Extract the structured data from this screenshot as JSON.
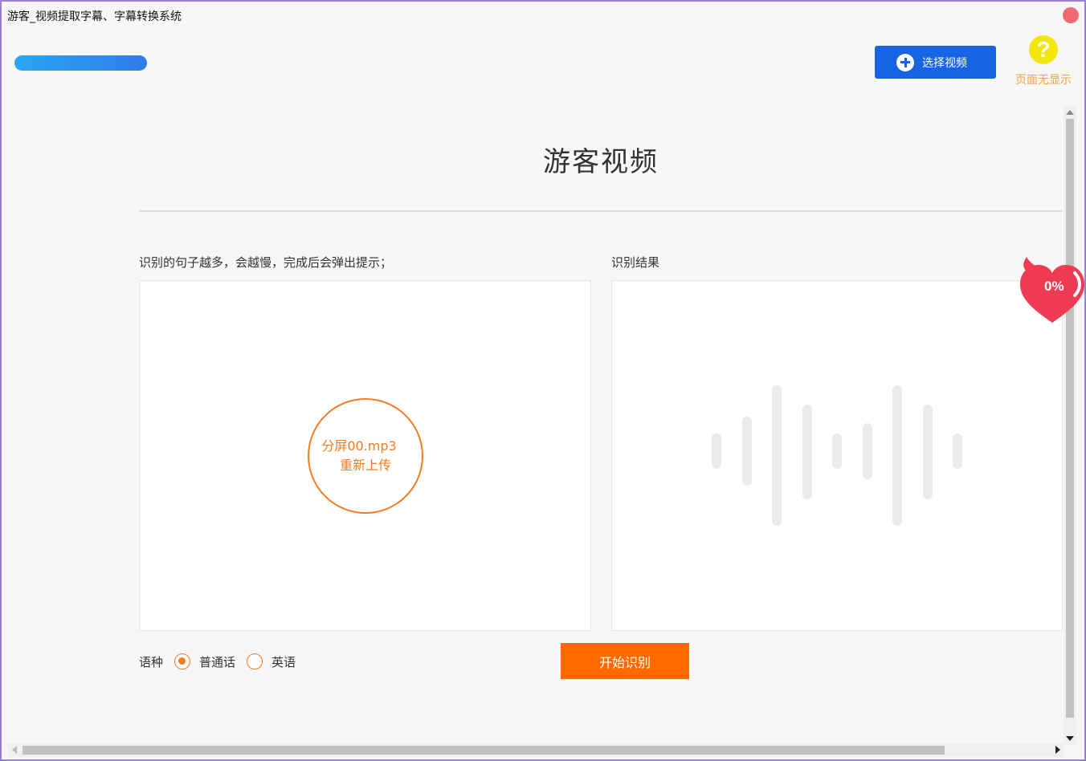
{
  "window": {
    "title": "游客_视频提取字幕、字幕转换系统"
  },
  "header": {
    "select_video_label": "选择视频",
    "help_label": "页面无显示",
    "help_glyph": "?"
  },
  "main": {
    "title": "游客视频",
    "source_hint": "识别的句子越多，会越慢，完成后会弹出提示；",
    "result_label": "识别结果",
    "upload": {
      "filename": "分屏00.mp3",
      "reupload_label": "重新上传"
    },
    "badge_percent": "0%"
  },
  "language": {
    "label": "语种",
    "options": [
      {
        "label": "普通话",
        "checked": true
      },
      {
        "label": "英语",
        "checked": false
      }
    ]
  },
  "actions": {
    "start_label": "开始识别"
  },
  "colors": {
    "accent_orange": "#f47c20",
    "button_blue": "#1664e0",
    "start_orange": "#ff6a00",
    "help_yellow": "#f3e60f"
  }
}
